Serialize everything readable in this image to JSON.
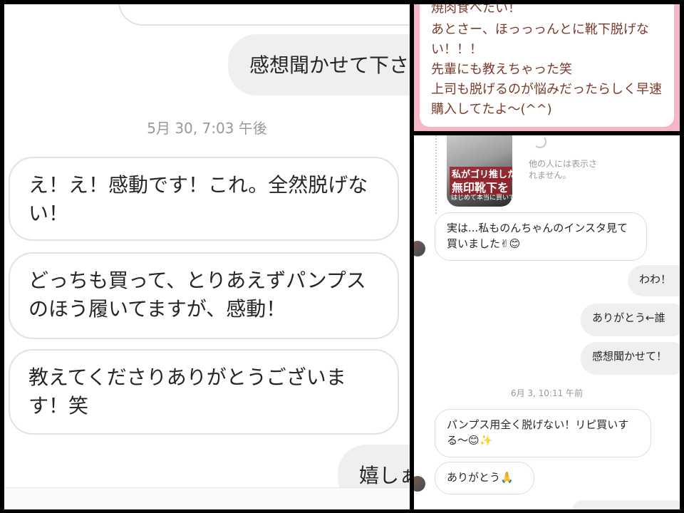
{
  "left_chat": {
    "prev_incoming_partial": "",
    "outgoing_1": "感想聞かせて下さ",
    "timestamp": "5月 30, 7:03 午後",
    "incoming": [
      "え！え！感動です！これ。全然脱げない！",
      "どっちも買って、とりあえずパンプスのほう履いてますが、感動！",
      "教えてくださりありがとうございます！笑"
    ],
    "outgoing_2": "嬉しぁ"
  },
  "review_card": {
    "lines": [
      "焼肉食べたい！",
      "あとさー、ほっっっんとに靴下脱げな",
      "い！！！",
      "先輩にも教えちゃった笑",
      "上司も脱げるのが悩みだったらしく早速",
      "購入してたよ〜(^^)"
    ]
  },
  "right_chat": {
    "story": {
      "line1": "私がゴリ推した",
      "line2": "無印靴下を",
      "line3": "はじめて本当に買いです"
    },
    "hidden_note": "他の人には表示されません。",
    "incoming_1": "実は...私ものんちゃんのインスタ見て買いました✌😊",
    "outgoing": [
      "わわ！",
      "ありがとう←誰",
      "感想聞かせて！"
    ],
    "timestamp": "6月 3, 10:11 午前",
    "incoming_2": "パンプス用全く脱げない！リピ買いする〜😊✨",
    "incoming_3": "ありがとう🙏"
  },
  "colors": {
    "frame": "#000000",
    "card_border": "#f4b7c6",
    "card_text": "#7a3a2a",
    "outgoing_bubble": "#efefef",
    "timestamp": "#999999"
  }
}
